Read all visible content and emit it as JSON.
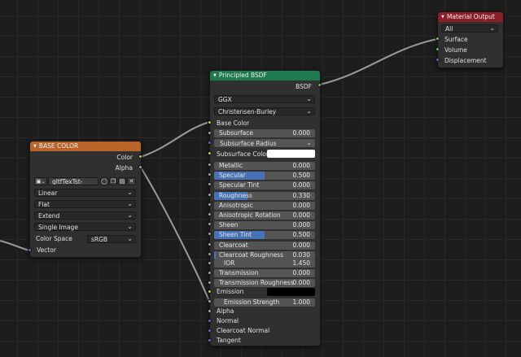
{
  "colors": {
    "background": "#1d1d1d",
    "wire": "#9a9a9a",
    "socket_color": "#c7c729",
    "socket_float": "#a1a1a1",
    "socket_vector": "#6363c7",
    "socket_shader": "#63c763",
    "slider_fill": "#4772b3",
    "emission_color": "#000000",
    "subsurface_color": "#ffffff"
  },
  "material_output": {
    "title": "Material Output",
    "target": "All",
    "inputs": [
      "Surface",
      "Volume",
      "Displacement"
    ]
  },
  "principled_bsdf": {
    "title": "Principled BSDF",
    "output": "BSDF",
    "distribution": "GGX",
    "subsurface_method": "Christensen-Burley",
    "base_color_label": "Base Color",
    "subsurface": {
      "label": "Subsurface",
      "value": "0.000"
    },
    "subsurface_radius": "Subsurface Radius",
    "subsurface_color_label": "Subsurface Color",
    "fields": [
      {
        "label": "Metallic",
        "value": "0.000",
        "fill": 0.0
      },
      {
        "label": "Specular",
        "value": "0.500",
        "fill": 0.5
      },
      {
        "label": "Specular Tint",
        "value": "0.000",
        "fill": 0.0
      },
      {
        "label": "Roughness",
        "value": "0.330",
        "fill": 0.33
      },
      {
        "label": "Anisotropic",
        "value": "0.000",
        "fill": 0.0
      },
      {
        "label": "Anisotropic Rotation",
        "value": "0.000",
        "fill": 0.0
      },
      {
        "label": "Sheen",
        "value": "0.000",
        "fill": 0.0
      },
      {
        "label": "Sheen Tint",
        "value": "0.500",
        "fill": 0.5
      },
      {
        "label": "Clearcoat",
        "value": "0.000",
        "fill": 0.0
      },
      {
        "label": "Clearcoat Roughness",
        "value": "0.030",
        "fill": 0.03
      }
    ],
    "ior": {
      "label": "IOR",
      "value": "1.450"
    },
    "transmission": {
      "label": "Transmission",
      "value": "0.000"
    },
    "transmission_roughness": {
      "label": "Transmission Roughness",
      "value": "0.000"
    },
    "emission_label": "Emission",
    "emission_strength": {
      "label": "Emission Strength",
      "value": "1.000"
    },
    "bottom_inputs": [
      "Alpha",
      "Normal",
      "Clearcoat Normal",
      "Tangent"
    ]
  },
  "base_color_node": {
    "title": "BASE COLOR",
    "outputs": [
      "Color",
      "Alpha"
    ],
    "image_name": "gltfTexTst-texIm...",
    "interpolation": "Linear",
    "projection": "Flat",
    "extension": "Extend",
    "source": "Single Image",
    "color_space_label": "Color Space",
    "color_space": "sRGB",
    "vector_label": "Vector"
  }
}
